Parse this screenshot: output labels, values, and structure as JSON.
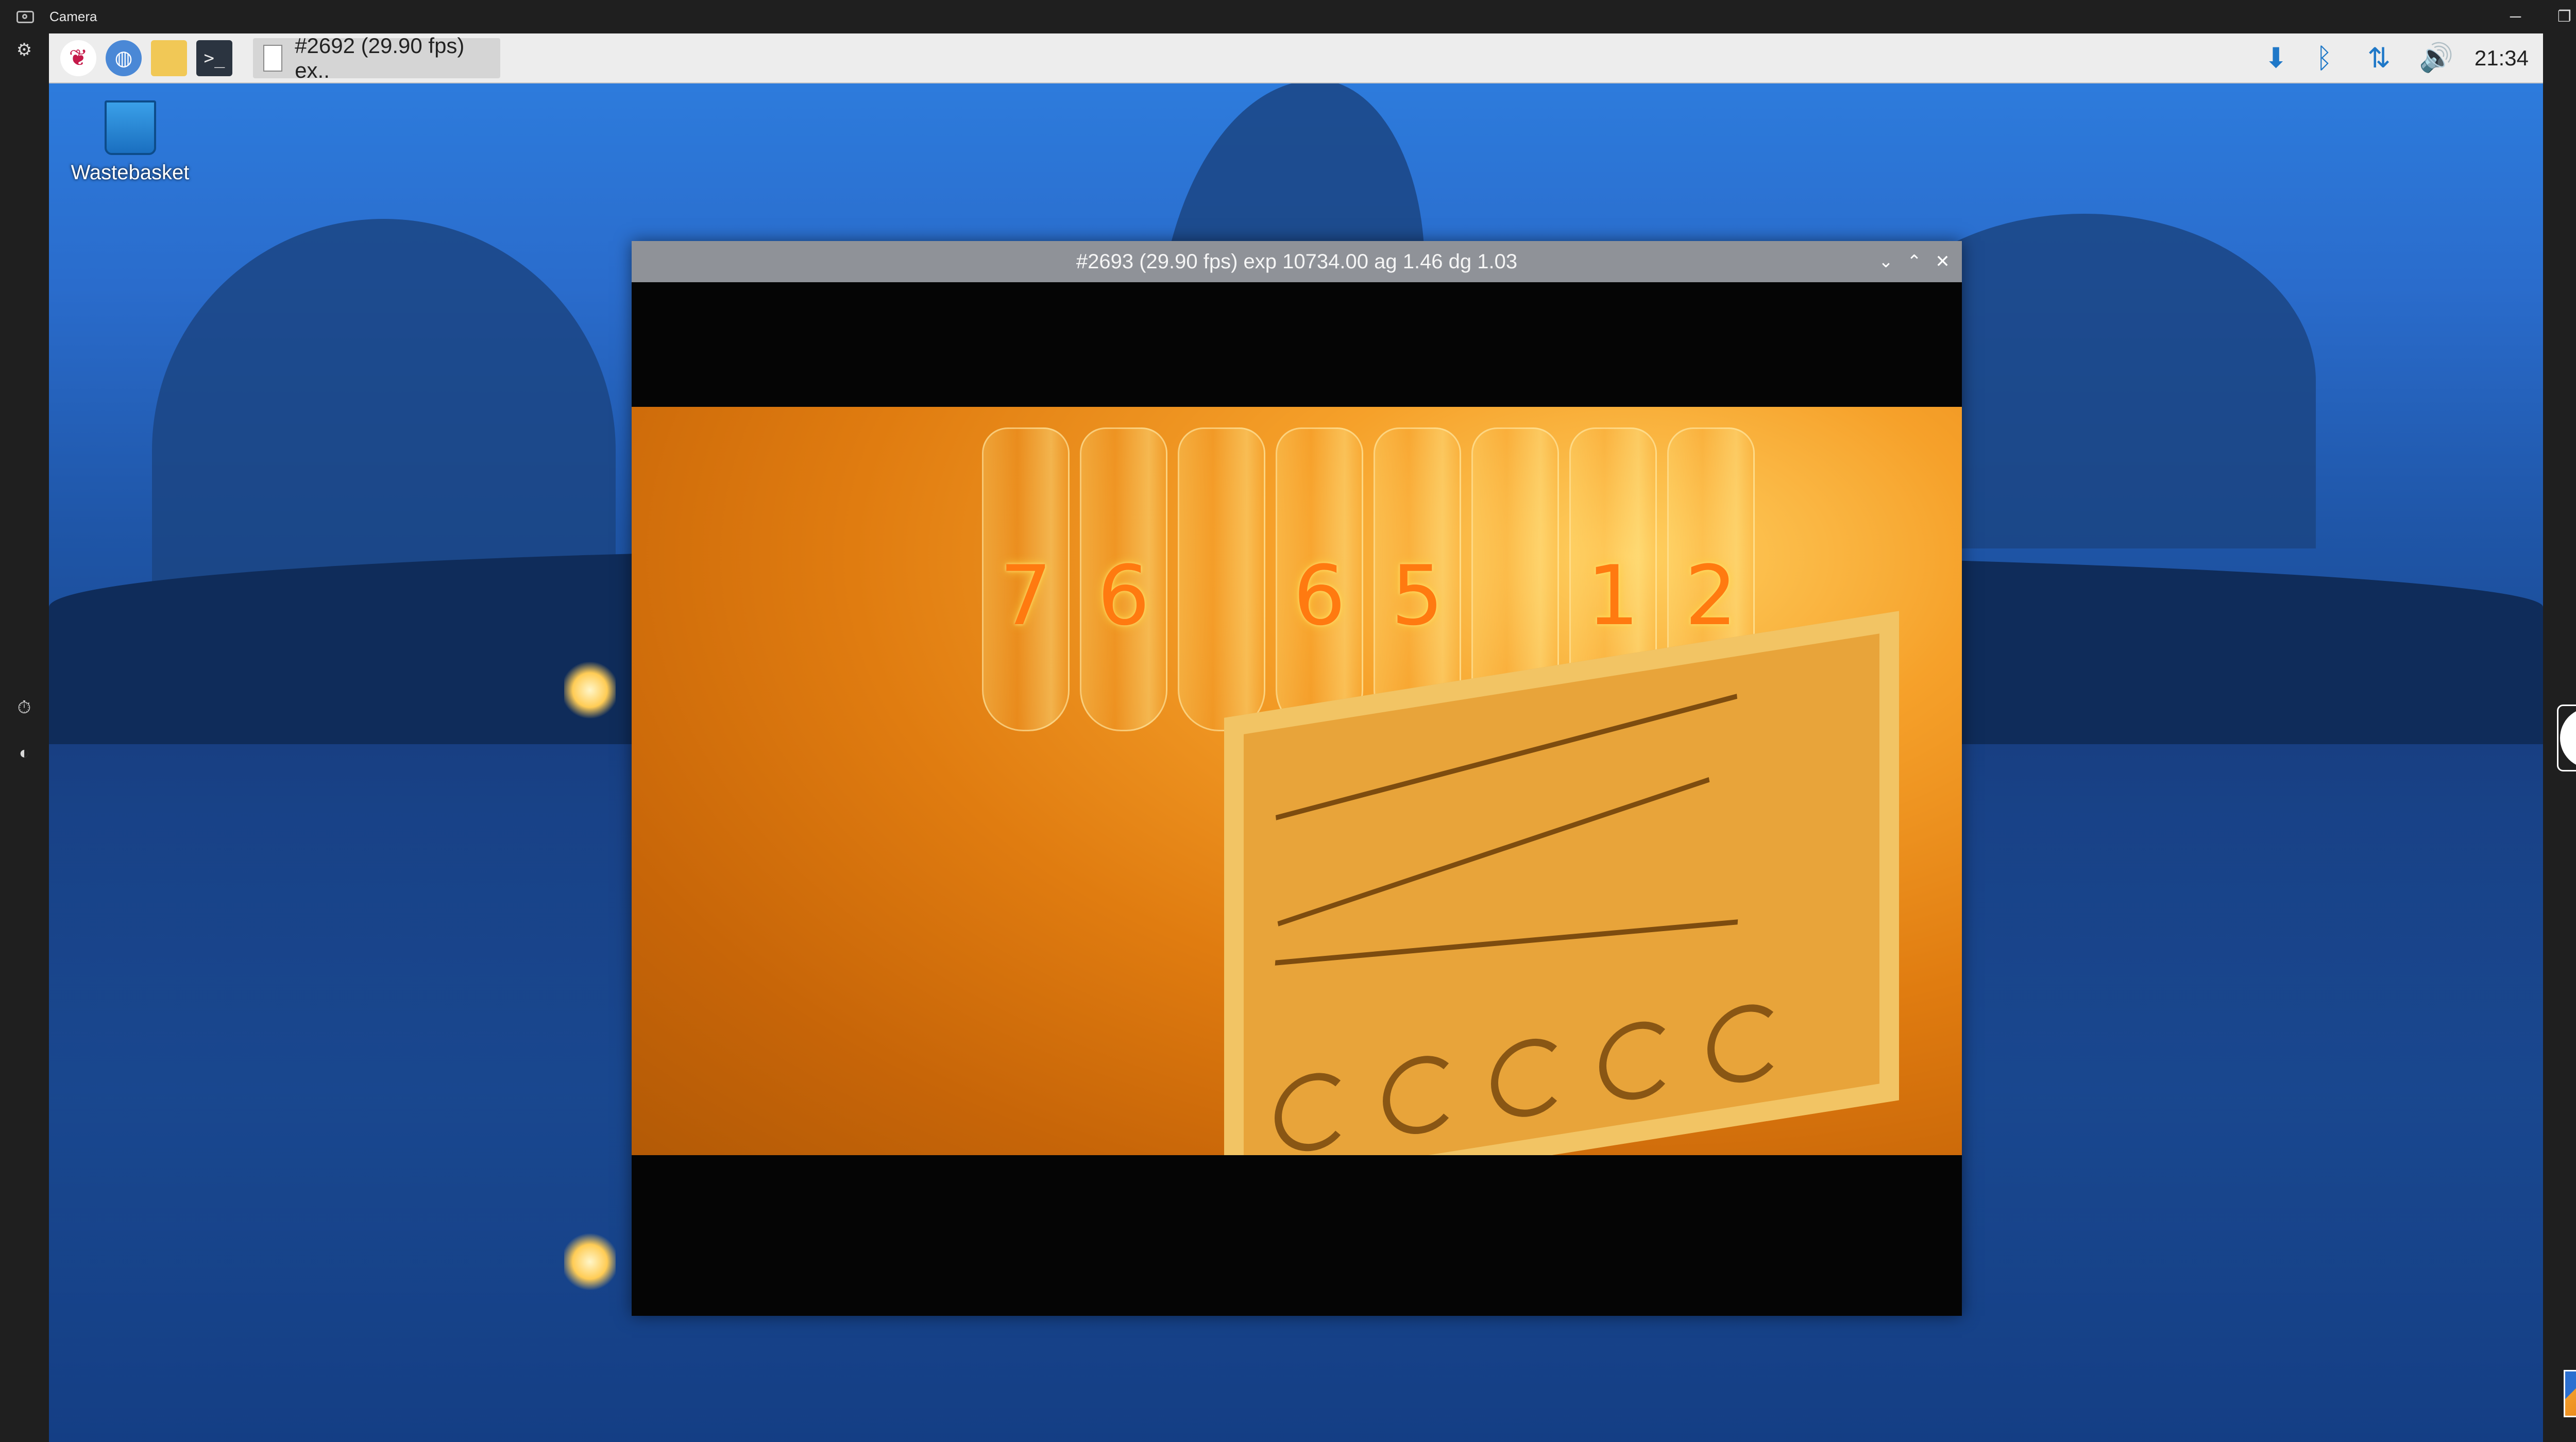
{
  "app": {
    "title": "Camera"
  },
  "window_controls": {
    "minimize": "─",
    "restore": "❐",
    "close": "✕"
  },
  "left_toolbar": {
    "settings": "⚙",
    "timer": "⏱",
    "exposure": "◐"
  },
  "taskbar": {
    "task_label": "#2692 (29.90 fps) ex..",
    "clock": "21:34",
    "icons": [
      "raspberry-pi-icon",
      "browser-icon",
      "file-manager-icon",
      "terminal-icon"
    ],
    "tray": [
      "download-icon",
      "bluetooth-icon",
      "network-icon",
      "volume-icon"
    ]
  },
  "desktop": {
    "wastebasket_label": "Wastebasket"
  },
  "preview": {
    "title": "#2693 (29.90 fps) exp 10734.00 ag 1.46 dg 1.03",
    "tube_digits": [
      "7",
      "6",
      "",
      "6",
      "5",
      "",
      "1",
      "2"
    ]
  },
  "right_controls": {
    "up": "⌃",
    "video": "▭",
    "photo": "◎",
    "scan": "▦",
    "down": "⌄"
  }
}
